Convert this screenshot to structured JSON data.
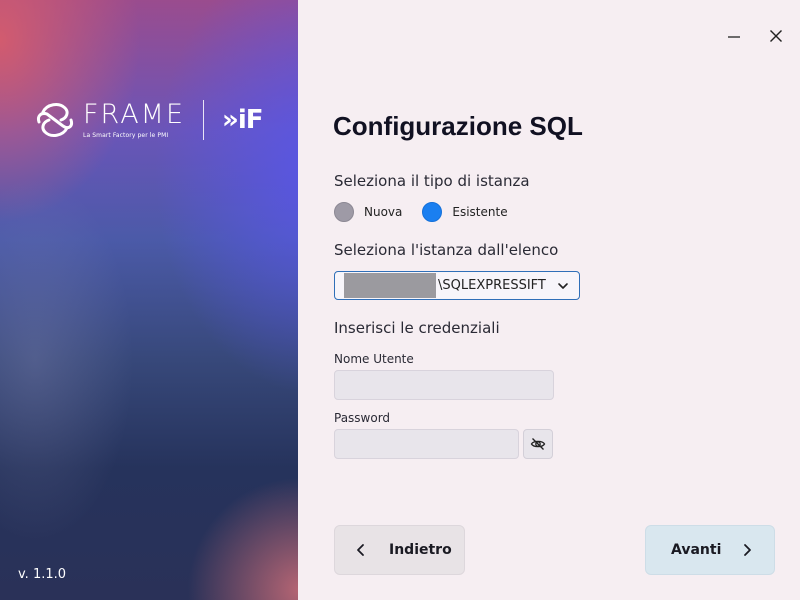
{
  "brand": {
    "wordmark": "FRAME",
    "tagline": "La Smart Factory per le PMI",
    "partner_logo": "»iF"
  },
  "version": "v. 1.1.0",
  "window_controls": {
    "minimize_icon": "minimize-icon",
    "close_icon": "close-icon"
  },
  "title": "Configurazione SQL",
  "instance_type": {
    "label": "Seleziona il tipo di istanza",
    "options": [
      {
        "label": "Nuova",
        "selected": false
      },
      {
        "label": "Esistente",
        "selected": true
      }
    ]
  },
  "instance_select": {
    "label": "Seleziona l'istanza dall'elenco",
    "value": "\\SQLEXPRESSIFT"
  },
  "credentials": {
    "label": "Inserisci le credenziali",
    "username_label": "Nome Utente",
    "username_value": "",
    "password_label": "Password",
    "password_value": "",
    "toggle_icon": "eye-off-icon"
  },
  "buttons": {
    "back": "Indietro",
    "next": "Avanti"
  },
  "colors": {
    "accent": "#1a7ff0",
    "select_border": "#2f6fb8",
    "next_button": "#d9e7ef",
    "back_button": "#e8e3e6"
  }
}
